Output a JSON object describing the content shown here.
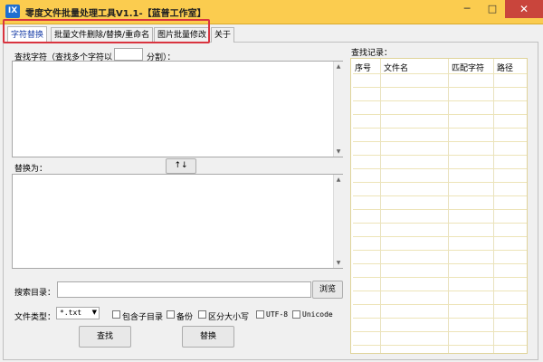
{
  "window": {
    "icon_text": "IX",
    "title": "零度文件批量处理工具V1.1-【蓝普工作室】",
    "minimize": "─",
    "maximize": "□",
    "close": "✕"
  },
  "tabs": [
    {
      "label": "字符替换",
      "active": true
    },
    {
      "label": "批量文件删除/替换/重命名",
      "active": false
    },
    {
      "label": "图片批量修改",
      "active": false
    },
    {
      "label": "关于",
      "active": false
    }
  ],
  "find": {
    "label_prefix": "查找字符（查找多个字符以",
    "separator_value": "",
    "label_suffix": "分割）：",
    "text": ""
  },
  "replace": {
    "label": "替换为：",
    "swap_button": "↑↓",
    "text": ""
  },
  "search_dir": {
    "label": "搜索目录：",
    "value": "",
    "browse_button": "浏览"
  },
  "file_type": {
    "label": "文件类型：",
    "selected": "*.txt"
  },
  "options": [
    {
      "label": "包含子目录",
      "checked": false
    },
    {
      "label": "备份",
      "checked": false
    },
    {
      "label": "区分大小写",
      "checked": false
    },
    {
      "label": "UTF-8",
      "checked": false
    },
    {
      "label": "Unicode",
      "checked": false
    }
  ],
  "actions": {
    "find_button": "查找",
    "replace_button": "替换"
  },
  "records": {
    "label": "查找记录：",
    "columns": [
      "序号",
      "文件名",
      "匹配字符",
      "路径"
    ]
  },
  "colors": {
    "title_bar": "#fbcc4f",
    "close_button": "#c9453c",
    "highlight_border": "#d9343f",
    "active_tab_text": "#1a3fa8"
  }
}
